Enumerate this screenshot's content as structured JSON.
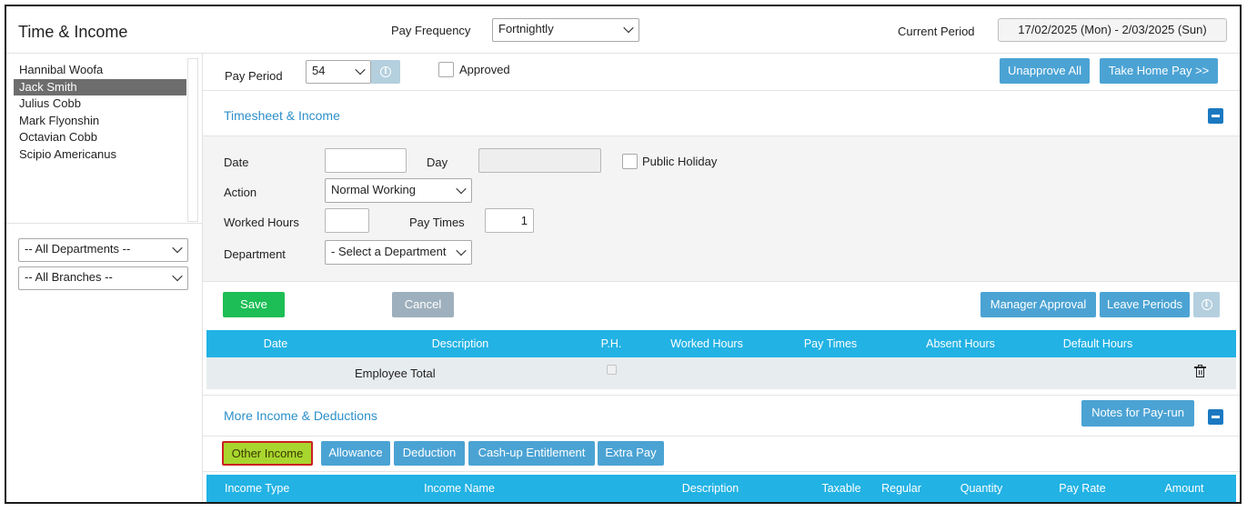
{
  "header": {
    "title": "Time & Income",
    "pay_frequency_label": "Pay Frequency",
    "pay_frequency_value": "Fortnightly",
    "current_period_label": "Current Period",
    "current_period_value": "17/02/2025 (Mon) - 2/03/2025 (Sun)"
  },
  "sidebar": {
    "employees": [
      {
        "name": "Hannibal Woofa"
      },
      {
        "name": "Jack Smith",
        "selected": true
      },
      {
        "name": "Julius Cobb"
      },
      {
        "name": "Mark Flyonshin"
      },
      {
        "name": "Octavian Cobb"
      },
      {
        "name": "Scipio Americanus"
      }
    ],
    "department_filter": "-- All Departments --",
    "branch_filter": "-- All Branches --"
  },
  "period_bar": {
    "pay_period_label": "Pay Period",
    "pay_period_value": "54",
    "approved_label": "Approved",
    "unapprove_all": "Unapprove All",
    "take_home_pay": "Take Home Pay >>"
  },
  "timesheet": {
    "title": "Timesheet & Income",
    "date_label": "Date",
    "date_value": "",
    "day_label": "Day",
    "day_value": "",
    "public_holiday_label": "Public Holiday",
    "action_label": "Action",
    "action_value": "Normal Working",
    "worked_hours_label": "Worked Hours",
    "worked_hours_value": "",
    "pay_times_label": "Pay Times",
    "pay_times_value": "1",
    "department_label": "Department",
    "department_value": "- Select a Department",
    "save": "Save",
    "cancel": "Cancel",
    "manager_approval": "Manager Approval",
    "leave_periods": "Leave Periods",
    "columns": [
      "Date",
      "Description",
      "P.H.",
      "Worked Hours",
      "Pay Times",
      "Absent Hours",
      "Default Hours"
    ],
    "total_row_label": "Employee Total"
  },
  "more_income": {
    "title": "More Income & Deductions",
    "notes_button": "Notes for Pay-run",
    "tabs": [
      "Other Income",
      "Allowance",
      "Deduction",
      "Cash-up Entitlement",
      "Extra Pay"
    ],
    "active_tab": "Other Income",
    "columns": [
      "Income Type",
      "Income Name",
      "Description",
      "Taxable",
      "Regular",
      "Quantity",
      "Pay Rate",
      "Amount"
    ]
  },
  "colors": {
    "accent_blue": "#4ba3d4",
    "table_header": "#22b2e4",
    "save_green": "#1dbe55",
    "active_tab": "#a8d62e",
    "highlight_border": "#cc2020"
  }
}
